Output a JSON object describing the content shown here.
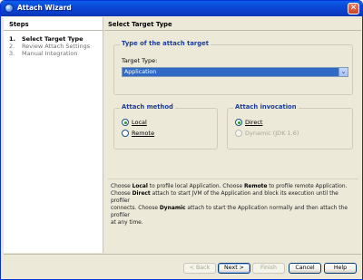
{
  "window": {
    "title": "Attach Wizard",
    "close_glyph": "✕"
  },
  "steps": {
    "title": "Steps",
    "items": [
      {
        "num": "1.",
        "label": "Select Target Type",
        "active": true
      },
      {
        "num": "2.",
        "label": "Review Attach Settings",
        "active": false
      },
      {
        "num": "3.",
        "label": "Manual Integration",
        "active": false
      }
    ]
  },
  "main": {
    "title": "Select Target Type",
    "target_group": {
      "title": "Type of the attach target",
      "field_label": "Target Type:",
      "selected": "Application",
      "arrow": "⌄"
    },
    "method_group": {
      "title": "Attach method",
      "options": [
        {
          "label": "Local",
          "checked": true
        },
        {
          "label": "Remote",
          "checked": false
        }
      ]
    },
    "invocation_group": {
      "title": "Attach invocation",
      "options": [
        {
          "label": "Direct",
          "checked": true
        },
        {
          "label": "Dynamic (JDK 1.6)",
          "checked": false,
          "disabled": true
        }
      ]
    },
    "description": {
      "l1a": "Choose ",
      "l1b": "Local",
      "l1c": " to profile local Application. Choose ",
      "l1d": "Remote",
      "l1e": " to profile remote Application.",
      "l2a": "Choose ",
      "l2b": "Direct",
      "l2c": " attach to start JVM of the Application and block its execution until the profiler",
      "l3a": "connects.  Choose ",
      "l3b": "Dynamic",
      "l3c": " attach to start the Application normally and then attach the profiler",
      "l4": "at any time."
    }
  },
  "buttons": {
    "back": "< Back",
    "next": "Next >",
    "finish": "Finish",
    "cancel": "Cancel",
    "help": "Help"
  }
}
